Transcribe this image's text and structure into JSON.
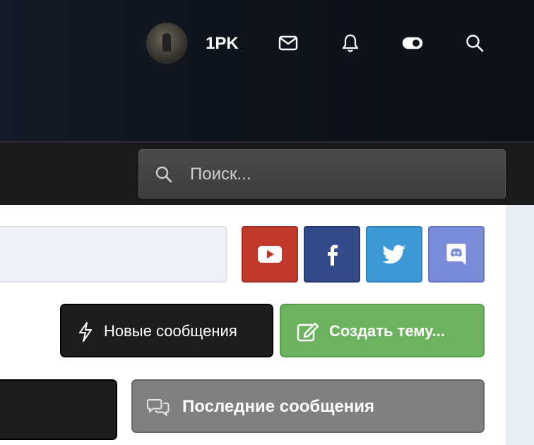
{
  "header": {
    "username": "1PK",
    "icons": [
      "mail-icon",
      "bell-icon",
      "theme-toggle-icon",
      "search-icon"
    ]
  },
  "search": {
    "placeholder": "Поиск..."
  },
  "social": [
    "youtube-icon",
    "facebook-icon",
    "twitter-icon",
    "discord-icon"
  ],
  "actions": {
    "new_messages": "Новые сообщения",
    "create_topic": "Создать тему...",
    "recent_messages": "Последние сообщения"
  },
  "colors": {
    "youtube": "#c0392b",
    "facebook": "#34498a",
    "twitter": "#3d98d6",
    "discord": "#7a8bd9",
    "create": "#6db35f",
    "recent": "#808080"
  }
}
